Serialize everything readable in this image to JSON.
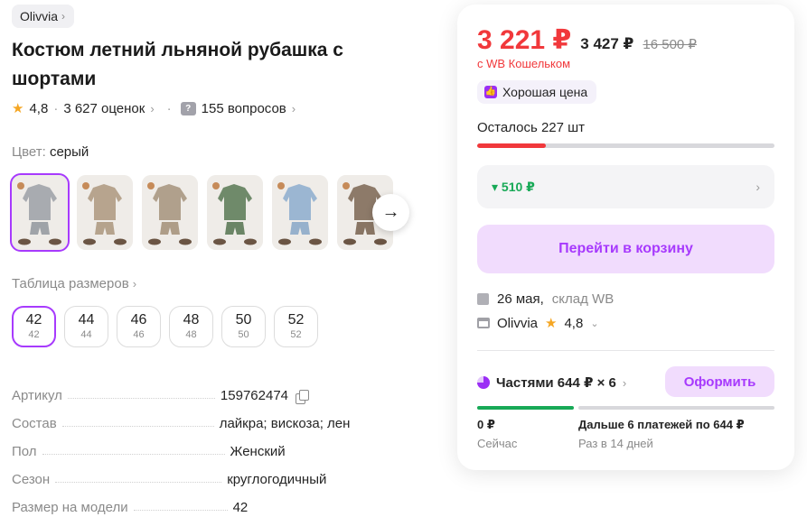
{
  "brand": {
    "name": "Olivvia"
  },
  "product": {
    "title": "Костюм летний льняной рубашка с шортами",
    "rating": "4,8",
    "reviews": "3 627 оценок",
    "questions": "155 вопросов"
  },
  "color": {
    "label": "Цвет:",
    "value": "серый"
  },
  "thumbnails": [
    {
      "name": "gray",
      "shirt": "#a8abb0",
      "bottom": "#9fa3a8"
    },
    {
      "name": "beige",
      "shirt": "#b7a48e",
      "bottom": "#b5a38d"
    },
    {
      "name": "taupe",
      "shirt": "#b0a08c",
      "bottom": "#ae9d88"
    },
    {
      "name": "green",
      "shirt": "#6f8a6a",
      "bottom": "#6b8566"
    },
    {
      "name": "blue",
      "shirt": "#9bb6d2",
      "bottom": "#97b1cc"
    },
    {
      "name": "brown",
      "shirt": "#8d7a69",
      "bottom": "#887564"
    }
  ],
  "sizes": {
    "table_link": "Таблица размеров",
    "items": [
      {
        "size": "42",
        "ru": "42"
      },
      {
        "size": "44",
        "ru": "44"
      },
      {
        "size": "46",
        "ru": "46"
      },
      {
        "size": "48",
        "ru": "48"
      },
      {
        "size": "50",
        "ru": "50"
      },
      {
        "size": "52",
        "ru": "52"
      }
    ]
  },
  "specs": [
    {
      "key": "Артикул",
      "value": "159762474"
    },
    {
      "key": "Состав",
      "value": "лайкра; вискоза; лен"
    },
    {
      "key": "Пол",
      "value": "Женский"
    },
    {
      "key": "Сезон",
      "value": "круглогодичный"
    },
    {
      "key": "Размер на модели",
      "value": "42"
    }
  ],
  "buy_card": {
    "price_now": "3 221 ₽",
    "price_mid": "3 427 ₽",
    "price_old": "16 500 ₽",
    "wallet_note": "с WB Кошельком",
    "good_price": "Хорошая цена",
    "stock_text": "Осталось 227 шт",
    "stock_level": 0.23,
    "discount": "▾ 510 ₽",
    "cart_button": "Перейти в корзину",
    "delivery_date": "26 мая,",
    "delivery_from": "склад WB",
    "seller_name": "Olivvia",
    "seller_rating": "4,8",
    "installments": "Частями 644 ₽ × 6",
    "order_button": "Оформить",
    "plan_now_amount": "0 ₽",
    "plan_now_label": "Сейчас",
    "plan_later_amount": "Дальше 6 платежей по 644 ₽",
    "plan_later_label": "Раз в 14 дней"
  },
  "colors": {
    "accent": "#a73afd",
    "price": "#f1383b",
    "green": "#18a957"
  }
}
